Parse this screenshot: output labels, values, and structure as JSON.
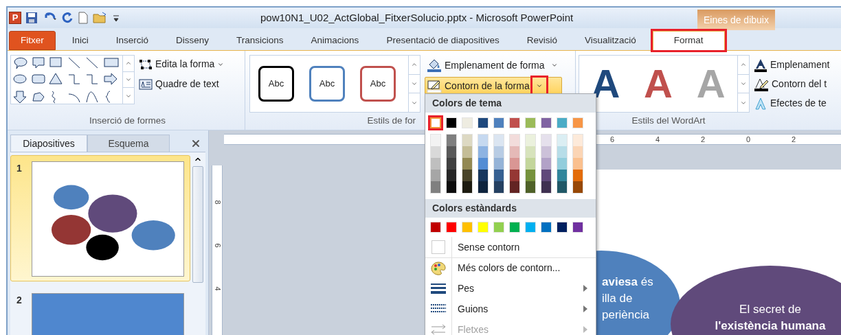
{
  "window": {
    "app_logo": "P",
    "title": "pow10N1_U02_ActGlobal_FitxerSolucio.pptx  -  Microsoft PowerPoint",
    "context_label": "Eines de dibuix"
  },
  "tabs": [
    {
      "label": "Fitxer",
      "kind": "file",
      "selected": false,
      "annotated": false
    },
    {
      "label": "Inici",
      "kind": "plain",
      "selected": false,
      "annotated": false
    },
    {
      "label": "Inserció",
      "kind": "plain",
      "selected": false,
      "annotated": false
    },
    {
      "label": "Disseny",
      "kind": "plain",
      "selected": false,
      "annotated": false
    },
    {
      "label": "Transicions",
      "kind": "plain",
      "selected": false,
      "annotated": false
    },
    {
      "label": "Animacions",
      "kind": "plain",
      "selected": false,
      "annotated": false
    },
    {
      "label": "Presentació de diapositives",
      "kind": "plain",
      "selected": false,
      "annotated": false
    },
    {
      "label": "Revisió",
      "kind": "plain",
      "selected": false,
      "annotated": false
    },
    {
      "label": "Visualització",
      "kind": "plain",
      "selected": false,
      "annotated": false
    },
    {
      "label": "Format",
      "kind": "context",
      "selected": true,
      "annotated": true
    }
  ],
  "ribbon": {
    "shapes_group": {
      "label": "Inserció de formes",
      "buttons": [
        {
          "label": "Edita la forma",
          "kind": "edit",
          "dropdown": true
        },
        {
          "label": "Quadre de text",
          "kind": "textbox",
          "dropdown": false
        }
      ]
    },
    "shape_styles_group": {
      "label": "Estils de for",
      "samples": [
        {
          "text": "Abc",
          "color": "#000000"
        },
        {
          "text": "Abc",
          "color": "#4f81bd"
        },
        {
          "text": "Abc",
          "color": "#c0504d"
        }
      ],
      "buttons": [
        {
          "label": "Emplenament de forma",
          "kind": "fill",
          "active": false,
          "arrow_annotated": false
        },
        {
          "label": "Contorn de la forma",
          "kind": "outline",
          "active": true,
          "arrow_annotated": true
        }
      ]
    },
    "wordart_group": {
      "label": "Estils del WordArt",
      "samples": [
        {
          "text": "A",
          "color": "#1f497d"
        },
        {
          "text": "A",
          "color": "#c0504d"
        },
        {
          "text": "A",
          "color": "#a6a6a6"
        }
      ],
      "buttons": [
        {
          "label": "Emplenament",
          "kind": "fill"
        },
        {
          "label": "Contorn del t",
          "kind": "outline"
        },
        {
          "label": "Efectes de te",
          "kind": "effects"
        }
      ]
    }
  },
  "outline_menu": {
    "theme_heading": "Colors de tema",
    "theme_colors": [
      {
        "color": "#ffffff",
        "selected": true,
        "shades": [
          {
            "color": "#f2f2f2"
          },
          {
            "color": "#d9d9d9"
          },
          {
            "color": "#bfbfbf"
          },
          {
            "color": "#a6a6a6"
          },
          {
            "color": "#808080"
          }
        ]
      },
      {
        "color": "#000000",
        "selected": false,
        "shades": [
          {
            "color": "#7f7f7f"
          },
          {
            "color": "#595959"
          },
          {
            "color": "#404040"
          },
          {
            "color": "#262626"
          },
          {
            "color": "#0d0d0d"
          }
        ]
      },
      {
        "color": "#eeece1",
        "selected": false,
        "shades": [
          {
            "color": "#ddd9c3"
          },
          {
            "color": "#c4bd97"
          },
          {
            "color": "#938953"
          },
          {
            "color": "#494429"
          },
          {
            "color": "#1d1b10"
          }
        ]
      },
      {
        "color": "#1f497d",
        "selected": false,
        "shades": [
          {
            "color": "#c6d9f0"
          },
          {
            "color": "#8db3e2"
          },
          {
            "color": "#548dd4"
          },
          {
            "color": "#17365d"
          },
          {
            "color": "#0f243e"
          }
        ]
      },
      {
        "color": "#4f81bd",
        "selected": false,
        "shades": [
          {
            "color": "#dbe5f1"
          },
          {
            "color": "#b8cce4"
          },
          {
            "color": "#95b3d7"
          },
          {
            "color": "#366092"
          },
          {
            "color": "#244061"
          }
        ]
      },
      {
        "color": "#c0504d",
        "selected": false,
        "shades": [
          {
            "color": "#f2dcdb"
          },
          {
            "color": "#e5b9b7"
          },
          {
            "color": "#d99694"
          },
          {
            "color": "#953734"
          },
          {
            "color": "#632423"
          }
        ]
      },
      {
        "color": "#9bbb59",
        "selected": false,
        "shades": [
          {
            "color": "#ebf1dd"
          },
          {
            "color": "#d7e3bc"
          },
          {
            "color": "#c3d69b"
          },
          {
            "color": "#76923c"
          },
          {
            "color": "#4f6128"
          }
        ]
      },
      {
        "color": "#8064a2",
        "selected": false,
        "shades": [
          {
            "color": "#e5e0ec"
          },
          {
            "color": "#ccc1d9"
          },
          {
            "color": "#b2a2c7"
          },
          {
            "color": "#5f497a"
          },
          {
            "color": "#3f3151"
          }
        ]
      },
      {
        "color": "#4bacc6",
        "selected": false,
        "shades": [
          {
            "color": "#dbeef3"
          },
          {
            "color": "#b7dde8"
          },
          {
            "color": "#92cddc"
          },
          {
            "color": "#31859b"
          },
          {
            "color": "#205867"
          }
        ]
      },
      {
        "color": "#f79646",
        "selected": false,
        "shades": [
          {
            "color": "#fdeada"
          },
          {
            "color": "#fbd5b5"
          },
          {
            "color": "#fac08f"
          },
          {
            "color": "#e36c09"
          },
          {
            "color": "#974806"
          }
        ]
      }
    ],
    "standard_heading": "Colors estàndards",
    "standard_colors": [
      {
        "color": "#c00000"
      },
      {
        "color": "#ff0000"
      },
      {
        "color": "#ffc000"
      },
      {
        "color": "#ffff00"
      },
      {
        "color": "#92d050"
      },
      {
        "color": "#00b050"
      },
      {
        "color": "#00b0f0"
      },
      {
        "color": "#0070c0"
      },
      {
        "color": "#002060"
      },
      {
        "color": "#7030a0"
      }
    ],
    "items": [
      {
        "label": "Sense contorn",
        "kind": "none",
        "disabled": false,
        "submenu": false
      },
      {
        "label": "Més colors de contorn...",
        "kind": "palette",
        "disabled": false,
        "submenu": false
      },
      {
        "label": "Pes",
        "kind": "weight",
        "disabled": false,
        "submenu": true
      },
      {
        "label": "Guions",
        "kind": "dashes",
        "disabled": false,
        "submenu": true
      },
      {
        "label": "Fletxes",
        "kind": "arrows",
        "disabled": true,
        "submenu": true
      }
    ]
  },
  "slides_panel": {
    "tabs": [
      {
        "label": "Diapositives",
        "selected": true
      },
      {
        "label": "Esquema",
        "selected": false
      }
    ],
    "slides": [
      {
        "number": "1",
        "kind": "bubbles",
        "selected": true
      },
      {
        "number": "2",
        "kind": "blue",
        "selected": false
      }
    ]
  },
  "rulers": {
    "horizontal": [
      "6",
      "4",
      "2",
      "0",
      "2"
    ],
    "vertical": [
      "8",
      "6",
      "4"
    ]
  },
  "slide": {
    "bubbles": [
      {
        "color": "#4f81bd",
        "lines": [
          "**aviesa** és",
          "illa de",
          "periència"
        ]
      },
      {
        "color": "#604a7b",
        "lines": [
          "El secret de",
          "**l'existència humana**"
        ]
      }
    ]
  }
}
